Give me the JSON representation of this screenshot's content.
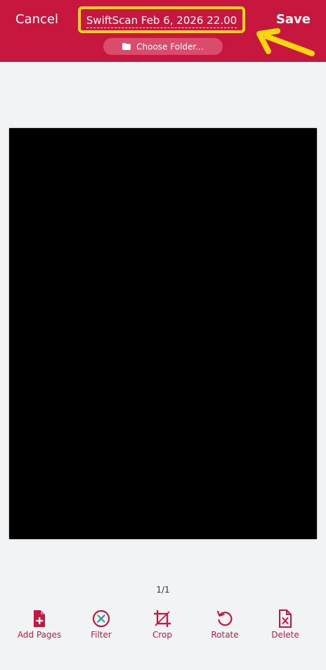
{
  "header": {
    "cancel_label": "Cancel",
    "save_label": "Save",
    "title": "SwiftScan Feb 6, 2026 22.00",
    "folder_label": "Choose Folder..."
  },
  "pager": {
    "text": "1/1"
  },
  "toolbar": {
    "add_pages": "Add Pages",
    "filter": "Filter",
    "crop": "Crop",
    "rotate": "Rotate",
    "delete": "Delete"
  },
  "icons": [
    "folder-icon",
    "add-page-icon",
    "filter-icon",
    "crop-icon",
    "rotate-icon",
    "delete-page-icon"
  ],
  "colors": {
    "brand": "#c8173f",
    "highlight": "#f5d90a",
    "background": "#f2f3f5"
  }
}
